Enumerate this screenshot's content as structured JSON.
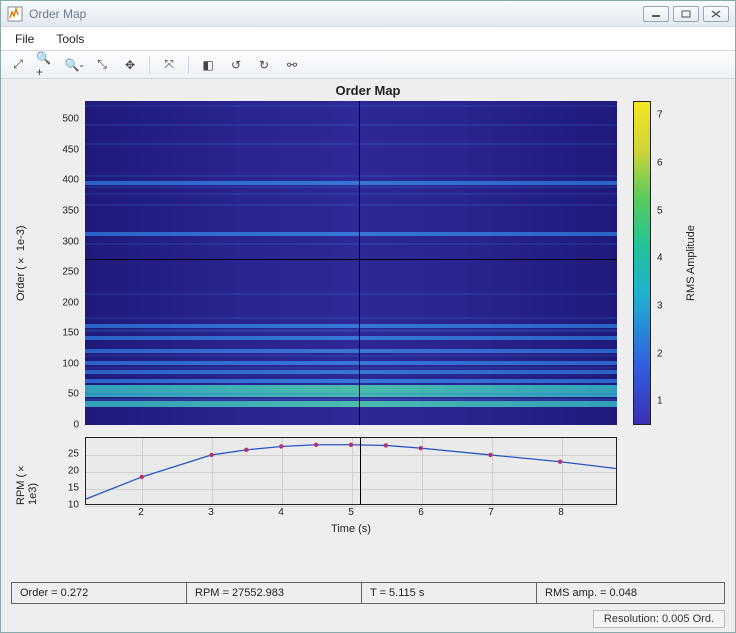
{
  "window": {
    "title": "Order Map"
  },
  "menu": {
    "file": "File",
    "tools": "Tools"
  },
  "toolbar": {
    "buttons": [
      {
        "name": "expand-icon",
        "glyph": "⤢"
      },
      {
        "name": "zoom-in-icon",
        "glyph": "🔍+"
      },
      {
        "name": "zoom-out-icon",
        "glyph": "🔍-"
      },
      {
        "name": "zoom-xy-icon",
        "glyph": "⤡"
      },
      {
        "name": "pan-icon",
        "glyph": "✥"
      },
      {
        "name": "sep1",
        "sep": true
      },
      {
        "name": "fit-icon",
        "glyph": "⤧"
      },
      {
        "name": "sep2",
        "sep": true
      },
      {
        "name": "brush-icon",
        "glyph": "◧"
      },
      {
        "name": "rotate-left-icon",
        "glyph": "↺"
      },
      {
        "name": "rotate-right-icon",
        "glyph": "↻"
      },
      {
        "name": "link-icon",
        "glyph": "⚯"
      }
    ]
  },
  "status": {
    "order": "Order = 0.272",
    "rpm": "RPM = 27552.983",
    "t": "T = 5.115 s",
    "rms": "RMS amp. = 0.048",
    "resolution": "Resolution: 0.005 Ord."
  },
  "chart_data": [
    {
      "type": "heatmap",
      "title": "Order Map",
      "xlabel": "Time (s)",
      "ylabel": "Order (× 1e-3)",
      "xlim": [
        1.2,
        8.8
      ],
      "ylim": [
        0,
        530
      ],
      "y_ticks": [
        0,
        50,
        100,
        150,
        200,
        250,
        300,
        350,
        400,
        450,
        500
      ],
      "colorbar_label": "RMS Amplitude",
      "colorbar_ticks": [
        1,
        2,
        3,
        4,
        5,
        6,
        7
      ],
      "cursor": {
        "x": 5.115,
        "y": 272
      },
      "bands": [
        {
          "y": 35,
          "strength": "strong"
        },
        {
          "y": 50,
          "strength": "strong"
        },
        {
          "y": 60,
          "strength": "strong"
        },
        {
          "y": 70,
          "strength": "weak"
        },
        {
          "y": 85,
          "strength": "weak"
        },
        {
          "y": 100,
          "strength": "weak"
        },
        {
          "y": 120,
          "strength": "weak"
        },
        {
          "y": 140,
          "strength": "weak"
        },
        {
          "y": 160,
          "strength": "weak"
        },
        {
          "y": 310,
          "strength": "weak"
        },
        {
          "y": 395,
          "strength": "weak"
        }
      ]
    },
    {
      "type": "line",
      "ylabel": "RPM (× 1e3)",
      "xlabel": "Time (s)",
      "xlim": [
        1.2,
        8.8
      ],
      "ylim": [
        10,
        30
      ],
      "x_ticks": [
        2,
        3,
        4,
        5,
        6,
        7,
        8
      ],
      "y_ticks": [
        10,
        15,
        20,
        25
      ],
      "x": [
        1.2,
        2,
        3,
        3.5,
        4,
        4.5,
        5,
        5.5,
        6,
        7,
        8,
        8.8
      ],
      "values": [
        12,
        18.5,
        25,
        26.5,
        27.5,
        28,
        28,
        27.8,
        27,
        25,
        23,
        21
      ],
      "markers_x": [
        2,
        3,
        3.5,
        4,
        4.5,
        5,
        5.5,
        6,
        7,
        8
      ],
      "cursor_x": 5.115
    }
  ]
}
